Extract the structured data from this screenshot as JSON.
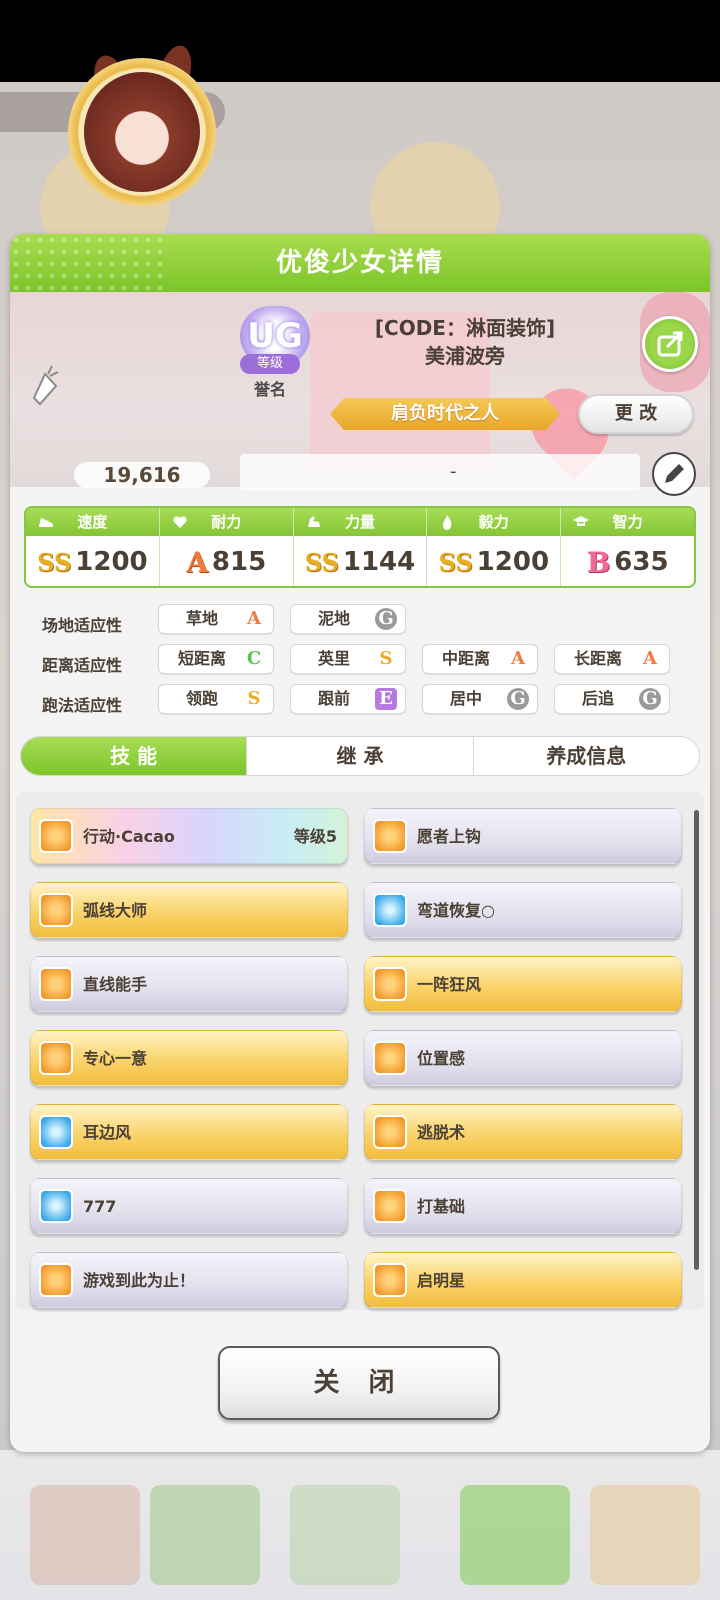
{
  "dialog": {
    "title": "优俊少女详情"
  },
  "profile": {
    "fans": "19,616",
    "rank_badge": "UG",
    "rank_tag": "等级",
    "rank_label": "誉名",
    "code_line": "[CODE：淋面装饰]",
    "name": "美浦波旁",
    "title_banner": "肩负时代之人",
    "change_label": "更 改",
    "comment": "-"
  },
  "stats": [
    {
      "label": "速度",
      "grade": "SS",
      "value": "1200",
      "icon": "shoe-icon"
    },
    {
      "label": "耐力",
      "grade": "A",
      "value": "815",
      "icon": "heart-icon"
    },
    {
      "label": "力量",
      "grade": "SS",
      "value": "1144",
      "icon": "muscle-icon"
    },
    {
      "label": "毅力",
      "grade": "SS",
      "value": "1200",
      "icon": "flame-icon"
    },
    {
      "label": "智力",
      "grade": "B",
      "value": "635",
      "icon": "graduation-cap-icon"
    }
  ],
  "aptitude": {
    "field_label": "场地适应性",
    "distance_label": "距离适应性",
    "style_label": "跑法适应性",
    "field": [
      {
        "name": "草地",
        "grade": "A"
      },
      {
        "name": "泥地",
        "grade": "G"
      }
    ],
    "distance": [
      {
        "name": "短距离",
        "grade": "C"
      },
      {
        "name": "英里",
        "grade": "S"
      },
      {
        "name": "中距离",
        "grade": "A"
      },
      {
        "name": "长距离",
        "grade": "A"
      }
    ],
    "style": [
      {
        "name": "领跑",
        "grade": "S"
      },
      {
        "name": "跟前",
        "grade": "E"
      },
      {
        "name": "居中",
        "grade": "G"
      },
      {
        "name": "后追",
        "grade": "G"
      }
    ]
  },
  "tabs": [
    "技 能",
    "继 承",
    "养成信息"
  ],
  "skills": [
    {
      "name": "行动·Cacao",
      "level": "等级5",
      "style": "rainbow",
      "icon": "orange"
    },
    {
      "name": "愿者上钩",
      "level": "",
      "style": "white",
      "icon": "orange"
    },
    {
      "name": "弧线大师",
      "level": "",
      "style": "gold",
      "icon": "orange"
    },
    {
      "name": "弯道恢复○",
      "level": "",
      "style": "white",
      "icon": "blue"
    },
    {
      "name": "直线能手",
      "level": "",
      "style": "white",
      "icon": "orange"
    },
    {
      "name": "一阵狂风",
      "level": "",
      "style": "gold",
      "icon": "orange"
    },
    {
      "name": "专心一意",
      "level": "",
      "style": "gold",
      "icon": "orange"
    },
    {
      "name": "位置感",
      "level": "",
      "style": "white",
      "icon": "orange"
    },
    {
      "name": "耳边风",
      "level": "",
      "style": "gold",
      "icon": "blue"
    },
    {
      "name": "逃脱术",
      "level": "",
      "style": "gold",
      "icon": "orange"
    },
    {
      "name": "777",
      "level": "",
      "style": "white",
      "icon": "blue"
    },
    {
      "name": "打基础",
      "level": "",
      "style": "white",
      "icon": "orange"
    },
    {
      "name": "游戏到此为止！",
      "level": "",
      "style": "white",
      "icon": "orange"
    },
    {
      "name": "启明星",
      "level": "",
      "style": "gold",
      "icon": "orange"
    }
  ],
  "close_label": "关 闭",
  "colors": {
    "accent_green": "#7cc52a",
    "gold": "#f2bd3e"
  }
}
